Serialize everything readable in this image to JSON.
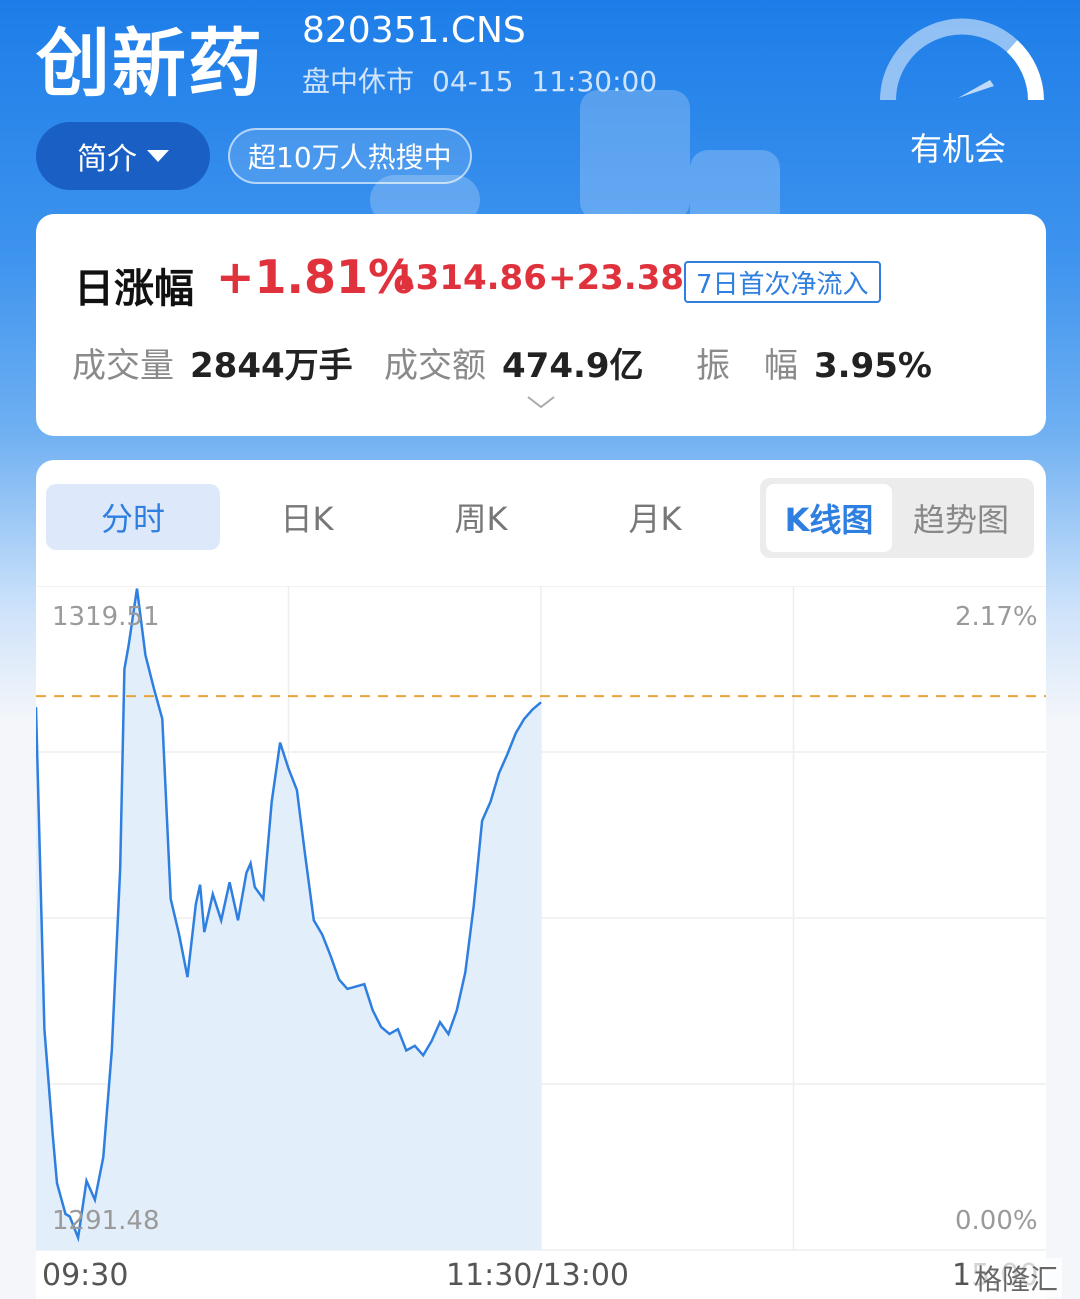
{
  "header": {
    "title": "创新药",
    "code": "820351.CNS",
    "market_status": "盘中休市",
    "date": "04-15",
    "time": "11:30:00",
    "intro_button": "简介",
    "hot_tag": "超10万人热搜中",
    "opportunity_label": "有机会"
  },
  "summary": {
    "change_label": "日涨幅",
    "change_percent": "+1.81%",
    "price": "1314.86",
    "change_amount": "+23.38",
    "flow_badge": "7日首次净流入",
    "volume_label": "成交量",
    "volume_value": "2844万手",
    "turnover_label": "成交额",
    "turnover_value": "474.9亿",
    "amplitude_label": "振　幅",
    "amplitude_value": "3.95%"
  },
  "chart_tabs": {
    "tabs": [
      "分时",
      "日K",
      "周K",
      "月K"
    ],
    "active_tab": "分时",
    "toggle": [
      "K线图",
      "趋势图"
    ],
    "active_toggle": "K线图"
  },
  "chart_data": {
    "type": "area",
    "y_left_labels": {
      "top": "1319.51",
      "bottom": "1291.48"
    },
    "y_right_labels": {
      "top": "2.17%",
      "bottom": "0.00%"
    },
    "ylim": [
      1291.48,
      1319.51
    ],
    "reference_price": 1314.86,
    "x_labels": [
      "09:30",
      "11:30/13:00",
      "15:00"
    ],
    "line_color": "#2f7fe0",
    "reference_line_color": "#e8a23c",
    "x_minutes": [
      0,
      2,
      4,
      5,
      7,
      8,
      10,
      12,
      14,
      16,
      18,
      20,
      21,
      22,
      24,
      26,
      28,
      30,
      32,
      34,
      36,
      38,
      39,
      40,
      42,
      44,
      46,
      48,
      50,
      51,
      52,
      54,
      56,
      58,
      60,
      62,
      64,
      66,
      68,
      70,
      72,
      74,
      76,
      78,
      80,
      82,
      84,
      86,
      88,
      90,
      92,
      94,
      96,
      98,
      100,
      102,
      104,
      106,
      108,
      110,
      112,
      114,
      116,
      118,
      120
    ],
    "values": [
      1314.4,
      1300.8,
      1296.3,
      1294.3,
      1293.0,
      1292.9,
      1292.0,
      1294.4,
      1293.6,
      1295.4,
      1299.9,
      1307.6,
      1316.0,
      1317.0,
      1319.4,
      1316.6,
      1315.2,
      1313.9,
      1306.3,
      1304.8,
      1303.0,
      1306.1,
      1306.9,
      1304.9,
      1306.5,
      1305.4,
      1307.0,
      1305.4,
      1307.4,
      1307.8,
      1306.8,
      1306.3,
      1310.4,
      1312.9,
      1311.8,
      1310.9,
      1308.1,
      1305.4,
      1304.8,
      1303.9,
      1302.9,
      1302.5,
      1302.6,
      1302.7,
      1301.6,
      1300.9,
      1300.6,
      1300.8,
      1299.9,
      1300.1,
      1299.7,
      1300.3,
      1301.1,
      1300.6,
      1301.6,
      1303.2,
      1306.0,
      1309.6,
      1310.4,
      1311.6,
      1312.4,
      1313.3,
      1313.9,
      1314.3,
      1314.6
    ],
    "total_minutes": 240
  },
  "watermark": "格隆汇"
}
